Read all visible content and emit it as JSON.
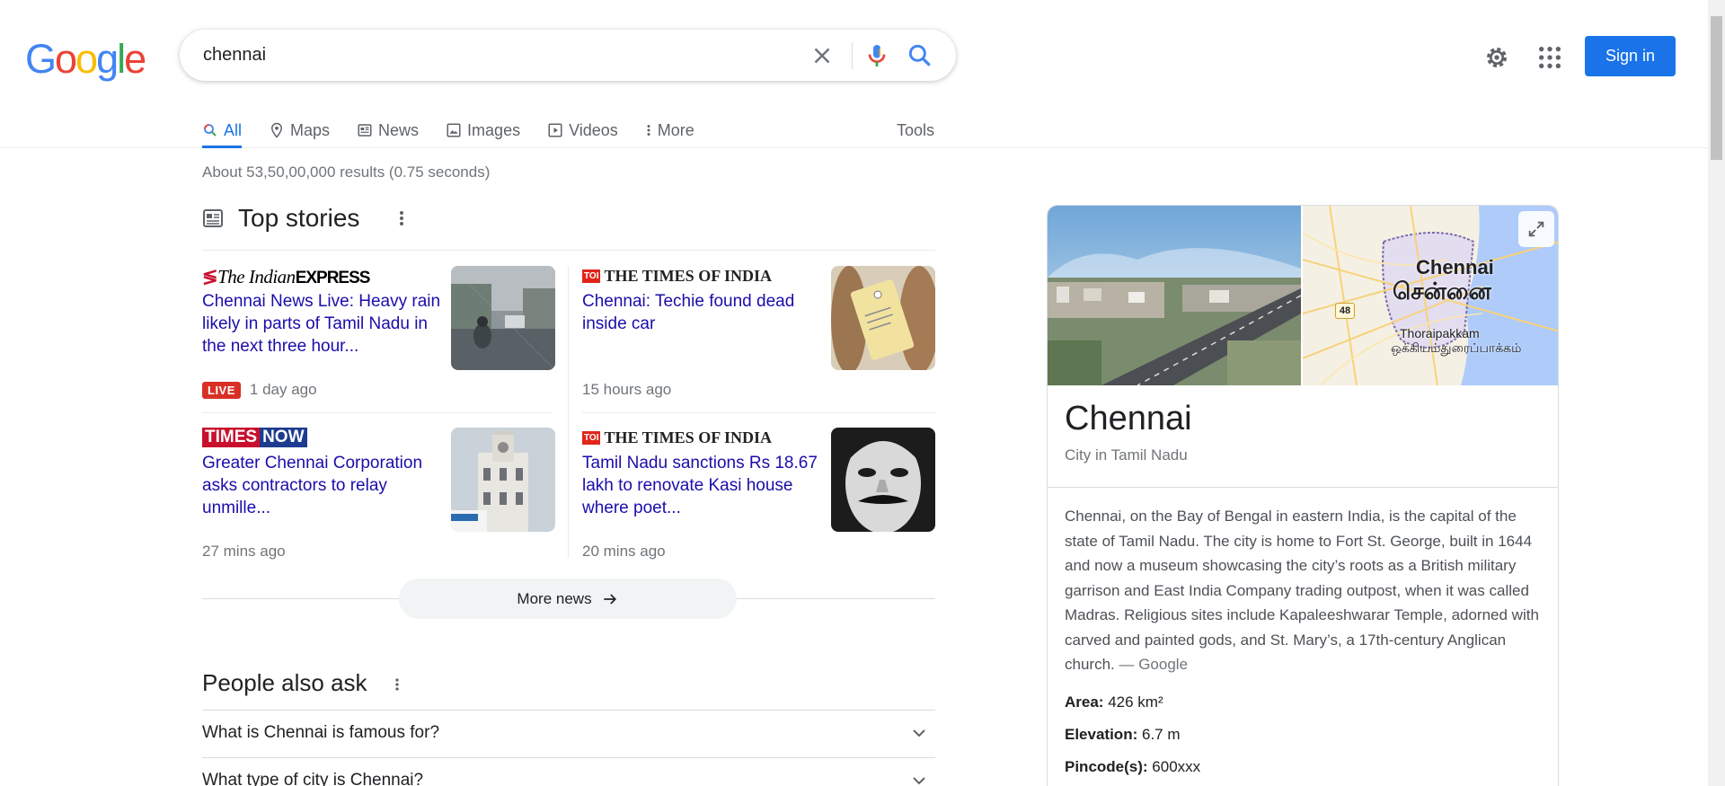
{
  "header": {
    "search_value": "chennai",
    "signin_label": "Sign in"
  },
  "tabs": [
    {
      "label": "All",
      "icon": "search-icon"
    },
    {
      "label": "Maps",
      "icon": "pin-icon"
    },
    {
      "label": "News",
      "icon": "newspaper-icon"
    },
    {
      "label": "Images",
      "icon": "image-icon"
    },
    {
      "label": "Videos",
      "icon": "play-icon"
    },
    {
      "label": "More",
      "icon": "kebab-icon"
    }
  ],
  "tools_label": "Tools",
  "result_stats": "About 53,50,00,000 results (0.75 seconds)",
  "top_stories": {
    "title": "Top stories",
    "stories": [
      {
        "source": "The Indian EXPRESS",
        "source_part1": "The Indian",
        "source_part2": "EXPRESS",
        "headline": "Chennai News Live: Heavy rain likely in parts of Tamil Nadu in the next three hour...",
        "live": "LIVE",
        "time": "1 day ago"
      },
      {
        "source": "THE TIMES OF INDIA",
        "source_badge": "TOI",
        "headline": "Chennai: Techie found dead inside car",
        "time": "15 hours ago"
      },
      {
        "source": "TIMES NOW",
        "source_part1": "TIMES",
        "source_part2": "NOW",
        "headline": "Greater Chennai Corporation asks contractors to relay unmille...",
        "time": "27 mins ago"
      },
      {
        "source": "THE TIMES OF INDIA",
        "source_badge": "TOI",
        "headline": "Tamil Nadu sanctions Rs 18.67 lakh to renovate Kasi house where poet...",
        "time": "20 mins ago"
      }
    ],
    "more_news_label": "More news"
  },
  "people_also_ask": {
    "title": "People also ask",
    "questions": [
      "What is Chennai is famous for?",
      "What type of city is Chennai?"
    ]
  },
  "knowledge_panel": {
    "title": "Chennai",
    "subtitle": "City in Tamil Nadu",
    "map_label_en": "Chennai",
    "map_label_ta": "சென்னை",
    "map_sublabel_en": "Thoraipakkam",
    "map_sublabel_ta": "ஒக்கியம்துரைப்பாக்கம்",
    "map_road_badge": "48",
    "description": "Chennai, on the Bay of Bengal in eastern India, is the capital of the state of Tamil Nadu. The city is home to Fort St. George, built in 1644 and now a museum showcasing the city’s roots as a British military garrison and East India Company trading outpost, when it was called Madras. Religious sites include Kapaleeshwarar Temple, adorned with carved and painted gods, and St. Mary’s, a 17th-century Anglican church.",
    "description_source": "— Google",
    "facts": [
      {
        "label": "Area:",
        "value": "426 km²"
      },
      {
        "label": "Elevation:",
        "value": "6.7 m"
      },
      {
        "label": "Pincode(s):",
        "value": "600xxx"
      }
    ]
  },
  "colors": {
    "accent": "#1a73e8",
    "link": "#1a0dab",
    "live": "#d93025"
  }
}
